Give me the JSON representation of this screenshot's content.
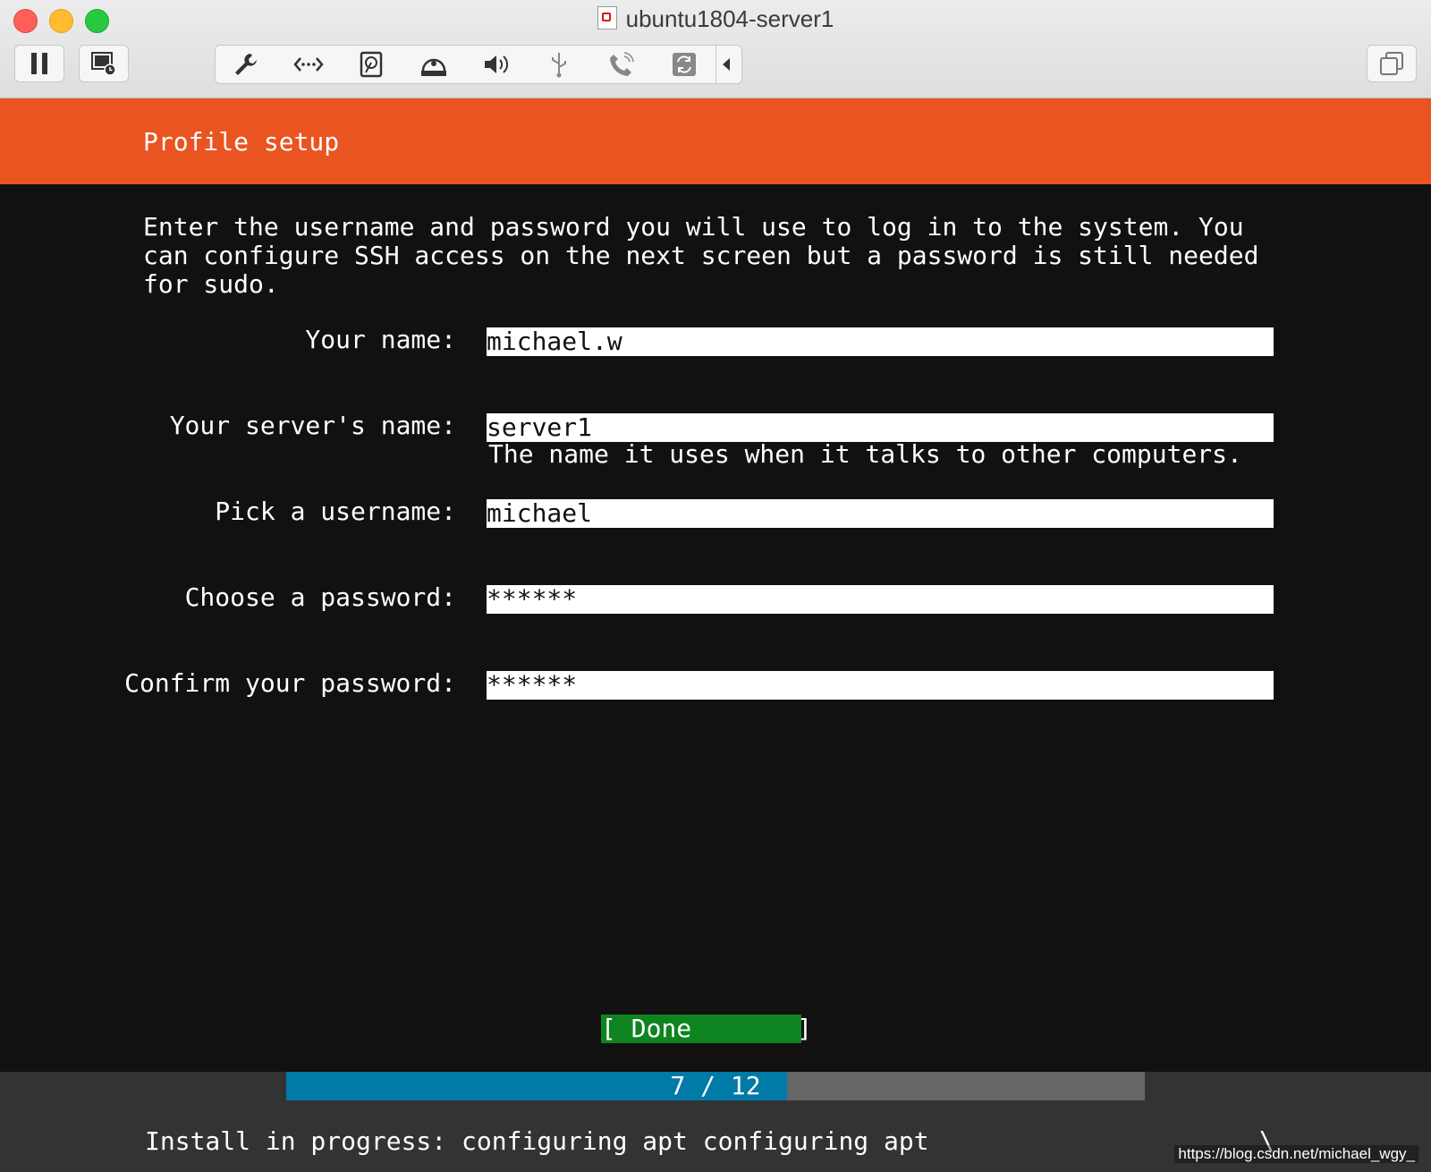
{
  "window": {
    "title": "ubuntu1804-server1"
  },
  "toolbar": {
    "icons": [
      "pause-icon",
      "snapshot-icon",
      "settings-icon",
      "network-icon",
      "hard-disk-icon",
      "cd-dvd-icon",
      "sound-icon",
      "usb-icon",
      "connect-icon",
      "shared-folder-icon",
      "collapse-icon",
      "window-mode-icon"
    ]
  },
  "header": {
    "title": "Profile setup"
  },
  "intro": "Enter the username and password you will use to log in to the system. You can configure SSH access on the next screen but a password is still needed for sudo.",
  "form": {
    "your_name": {
      "label": "Your name:",
      "value": "michael.w"
    },
    "server_name": {
      "label": "Your server's name:",
      "value": "server1",
      "hint": "The name it uses when it talks to other computers."
    },
    "username": {
      "label": "Pick a username:",
      "value": "michael"
    },
    "password": {
      "label": "Choose a password:",
      "value": "******"
    },
    "confirm_password": {
      "label": "Confirm your password:",
      "value": "******"
    }
  },
  "done_button": {
    "label": "[ Done       ]"
  },
  "progress": {
    "text": "7 / 12",
    "current": 7,
    "total": 12
  },
  "status": {
    "text": "Install in progress: configuring apt configuring apt",
    "spinner": "\\"
  },
  "watermark": "https://blog.csdn.net/michael_wgy_",
  "colors": {
    "header": "#e95420",
    "done": "#0e8420",
    "progress": "#007aa6"
  }
}
